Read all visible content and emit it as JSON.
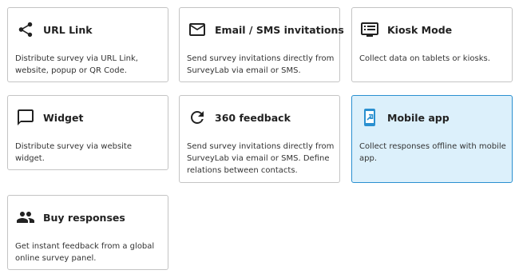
{
  "cards": [
    {
      "title": "URL Link",
      "desc": "Distribute survey via URL Link, website, popup or QR Code.",
      "icon": "share-icon"
    },
    {
      "title": "Email / SMS invitations",
      "desc": "Send survey invitations directly from SurveyLab via email or SMS.",
      "icon": "envelope-icon"
    },
    {
      "title": "Kiosk Mode",
      "desc": "Collect data on tablets or kiosks.",
      "icon": "kiosk-icon"
    },
    {
      "title": "Widget",
      "desc": "Distribute survey via website widget.",
      "icon": "chat-bubble-icon"
    },
    {
      "title": "360 feedback",
      "desc": "Send survey invitations directly from SurveyLab via email or SMS. Define relations between contacts.",
      "icon": "refresh-icon"
    },
    {
      "title": "Mobile app",
      "desc": "Collect responses offline with mobile app.",
      "icon": "mobile-icon"
    },
    {
      "title": "Buy responses",
      "desc": "Get instant feedback from a global online survey panel.",
      "icon": "people-icon"
    }
  ],
  "selected_card": "Mobile app",
  "colors": {
    "selected_bg": "#dcf0fb",
    "selected_border": "#2a90d0",
    "mobile_icon": "#2a90d0",
    "border": "#c4c4c4"
  }
}
